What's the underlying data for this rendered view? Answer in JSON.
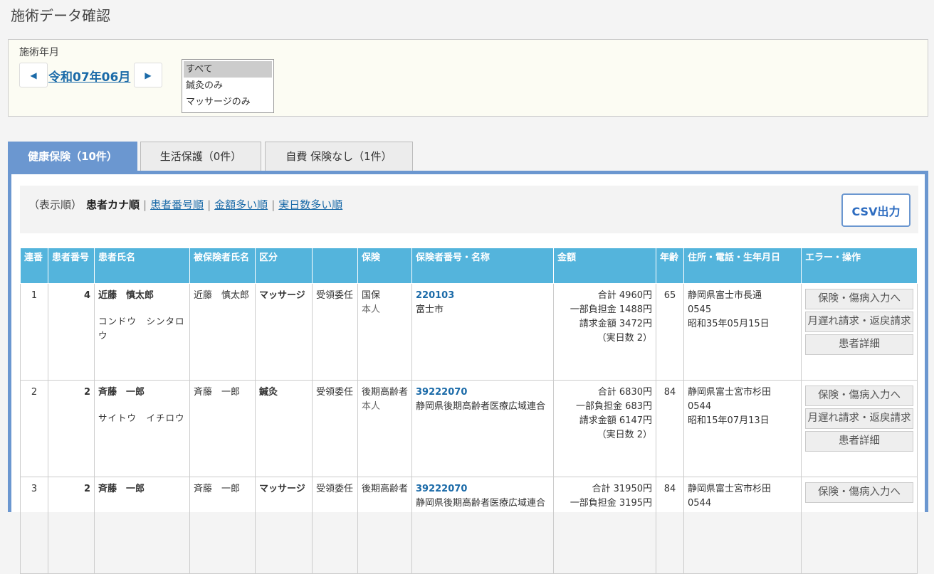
{
  "page_title": "施術データ確認",
  "filter": {
    "label": "施術年月",
    "month": "令和07年06月",
    "types": [
      "すべて",
      "鍼灸のみ",
      "マッサージのみ"
    ],
    "selected_type": "すべて"
  },
  "tabs": [
    {
      "label": "健康保険（10件）"
    },
    {
      "label": "生活保護（0件）"
    },
    {
      "label": "自費 保険なし（1件）"
    }
  ],
  "sort": {
    "prefix": "（表示順）",
    "current": "患者カナ順",
    "options": [
      "患者番号順",
      "金額多い順",
      "実日数多い順"
    ]
  },
  "csv_label": "CSV出力",
  "table": {
    "headers": [
      "連番",
      "患者番号",
      "患者氏名",
      "被保険者氏名",
      "区分",
      "",
      "保険",
      "保険者番号・名称",
      "金額",
      "年齢",
      "住所・電話・生年月日",
      "エラー・操作"
    ],
    "rows": [
      {
        "no": "1",
        "patient_no": "4",
        "name": "近藤　慎太郎",
        "kana": "コンドウ　シンタロウ",
        "insured": "近藤　慎太郎",
        "category": "マッサージ",
        "claim": "受領委任",
        "insurance": "国保",
        "insurance_sub": "本人",
        "insurer_no": "220103",
        "insurer_name": "富士市",
        "total": "合計 4960円",
        "copay": "一部負担金 1488円",
        "billed": "請求金額 3472円",
        "days": "（実日数 2）",
        "age": "65",
        "address": "静岡県富士市長通",
        "phone": "0545",
        "birth": "昭和35年05月15日",
        "ops": [
          "保険・傷病入力へ",
          "月遅れ請求・返戻請求",
          "患者詳細"
        ]
      },
      {
        "no": "2",
        "patient_no": "2",
        "name": "斉藤　一郎",
        "kana": "サイトウ　イチロウ",
        "insured": "斉藤　一郎",
        "category": "鍼灸",
        "claim": "受領委任",
        "insurance": "後期高齢者",
        "insurance_sub": "本人",
        "insurer_no": "39222070",
        "insurer_name": "静岡県後期高齢者医療広域連合",
        "total": "合計 6830円",
        "copay": "一部負担金 683円",
        "billed": "請求金額 6147円",
        "days": "（実日数 2）",
        "age": "84",
        "address": "静岡県富士宮市杉田",
        "phone": "0544",
        "birth": "昭和15年07月13日",
        "ops": [
          "保険・傷病入力へ",
          "月遅れ請求・返戻請求",
          "患者詳細"
        ]
      },
      {
        "no": "3",
        "patient_no": "2",
        "name": "斉藤　一郎",
        "kana": "",
        "insured": "斉藤　一郎",
        "category": "マッサージ",
        "claim": "受領委任",
        "insurance": "後期高齢者",
        "insurance_sub": "",
        "insurer_no": "39222070",
        "insurer_name": "静岡県後期高齢者医療広域連合",
        "total": "合計 31950円",
        "copay": "一部負担金 3195円",
        "billed": "",
        "days": "",
        "age": "84",
        "address": "静岡県富士宮市杉田",
        "phone": "0544",
        "birth": "",
        "ops": [
          "保険・傷病入力へ"
        ]
      }
    ]
  }
}
